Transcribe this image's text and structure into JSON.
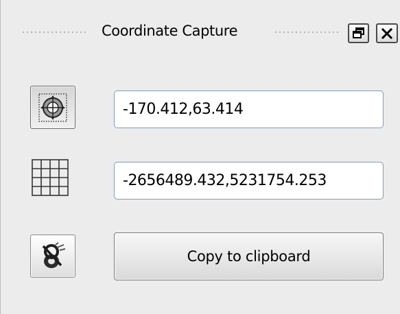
{
  "dock": {
    "title": "Coordinate Capture",
    "float_icon": "restore-window-icon",
    "close_icon": "close-icon"
  },
  "rows": [
    {
      "icon": "geographic-crs-icon",
      "value": "-170.412,63.414"
    },
    {
      "icon": "projected-crs-grid-icon",
      "value": "-2656489.432,5231754.253"
    }
  ],
  "capture_icon": "capture-cursor-icon",
  "copy_button": {
    "label": "Copy to clipboard"
  },
  "colors": {
    "panel_background": "#ececec",
    "field_border": "#7f9db9",
    "button_border": "#7a7a7a"
  }
}
